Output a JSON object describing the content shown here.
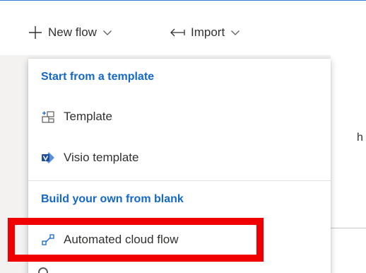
{
  "toolbar": {
    "new_flow_label": "New flow",
    "import_label": "Import"
  },
  "menu": {
    "section_template_header": "Start from a template",
    "template_label": "Template",
    "visio_template_label": "Visio template",
    "section_blank_header": "Build your own from blank",
    "automated_cloud_flow_label": "Automated cloud flow"
  },
  "background": {
    "truncated_letter": "h"
  },
  "colors": {
    "accent": "#1468c8",
    "highlight": "#f00000",
    "top_border": "#3a7bd5"
  },
  "icons": {
    "new_flow": "plus-icon",
    "import": "import-arrow-icon",
    "dropdown": "chevron-down-icon",
    "template": "template-icon",
    "visio": "visio-icon",
    "automated": "flow-connector-icon"
  }
}
